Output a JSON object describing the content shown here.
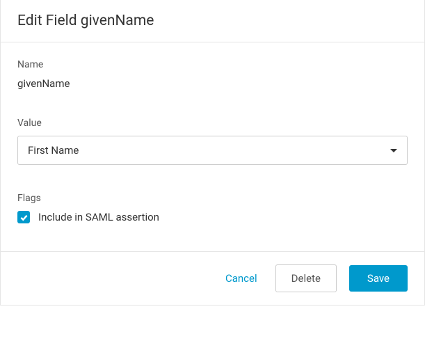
{
  "dialog": {
    "title": "Edit Field givenName"
  },
  "fields": {
    "name": {
      "label": "Name",
      "value": "givenName"
    },
    "value": {
      "label": "Value",
      "selected": "First Name"
    },
    "flags": {
      "label": "Flags",
      "include_saml": {
        "label": "Include in SAML assertion",
        "checked": true
      }
    }
  },
  "footer": {
    "cancel": "Cancel",
    "delete": "Delete",
    "save": "Save"
  },
  "colors": {
    "accent": "#0099cc"
  }
}
